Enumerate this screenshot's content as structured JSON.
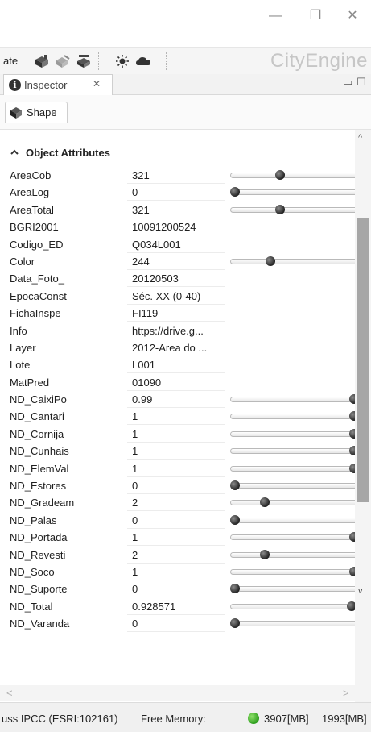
{
  "window": {
    "minimize_glyph": "—",
    "restore_glyph": "❐",
    "close_glyph": "✕"
  },
  "toolbar": {
    "truncated_label": "ate",
    "icons": [
      "shapes-icon",
      "shapes-disabled-icon",
      "shapes-edit-icon",
      "sun-icon",
      "cloud-icon"
    ],
    "brand": "CityEngine"
  },
  "inspector": {
    "tab_label": "Inspector",
    "close_glyph": "✕",
    "min_glyph": "▭",
    "max_glyph": "☐",
    "sub_tab_label": "Shape"
  },
  "attributes": {
    "section_title": "Object Attributes",
    "rows": [
      {
        "name": "AreaCob",
        "value": "321",
        "slider": 0.38
      },
      {
        "name": "AreaLog",
        "value": "0",
        "slider": 0.0
      },
      {
        "name": "AreaTotal",
        "value": "321",
        "slider": 0.38
      },
      {
        "name": "BGRI2001",
        "value": "10091200524",
        "slider": null
      },
      {
        "name": "Codigo_ED",
        "value": "Q034L001",
        "slider": null
      },
      {
        "name": "Color",
        "value": "244",
        "slider": 0.3
      },
      {
        "name": "Data_Foto_",
        "value": "20120503",
        "slider": null
      },
      {
        "name": "EpocaConst",
        "value": "Séc. XX (0-40)",
        "slider": null
      },
      {
        "name": "FichaInspe",
        "value": "FI119",
        "slider": null
      },
      {
        "name": "Info",
        "value": "https://drive.g...",
        "slider": null
      },
      {
        "name": "Layer",
        "value": "2012-Area do ...",
        "slider": null
      },
      {
        "name": "Lote",
        "value": "L001",
        "slider": null
      },
      {
        "name": "MatPred",
        "value": "01090",
        "slider": null
      },
      {
        "name": "ND_CaixiPo",
        "value": "0.99",
        "slider": 1.0
      },
      {
        "name": "ND_Cantari",
        "value": "1",
        "slider": 1.0
      },
      {
        "name": "ND_Cornija",
        "value": "1",
        "slider": 1.0
      },
      {
        "name": "ND_Cunhais",
        "value": "1",
        "slider": 1.0
      },
      {
        "name": "ND_ElemVal",
        "value": "1",
        "slider": 1.0
      },
      {
        "name": "ND_Estores",
        "value": "0",
        "slider": 0.0
      },
      {
        "name": "ND_Gradeam",
        "value": "2",
        "slider": 0.25
      },
      {
        "name": "ND_Palas",
        "value": "0",
        "slider": 0.0
      },
      {
        "name": "ND_Portada",
        "value": "1",
        "slider": 1.0
      },
      {
        "name": "ND_Revesti",
        "value": "2",
        "slider": 0.25
      },
      {
        "name": "ND_Soco",
        "value": "1",
        "slider": 1.0
      },
      {
        "name": "ND_Suporte",
        "value": "0",
        "slider": 0.0
      },
      {
        "name": "ND_Total",
        "value": "0.928571",
        "slider": 0.98
      },
      {
        "name": "ND_Varanda",
        "value": "0",
        "slider": 0.0
      }
    ]
  },
  "scroll": {
    "up_glyph": "^",
    "down_glyph": "v",
    "left_glyph": "<",
    "right_glyph": ">"
  },
  "status": {
    "crs": "uss IPCC (ESRI:102161)",
    "free_memory_label": "Free Memory:",
    "free_memory_value": "3907[MB]",
    "total_memory_value": "1993[MB]"
  },
  "colors": {
    "memory_indicator": "#2e9e1e",
    "scroll_thumb": "#a6a6a6"
  }
}
